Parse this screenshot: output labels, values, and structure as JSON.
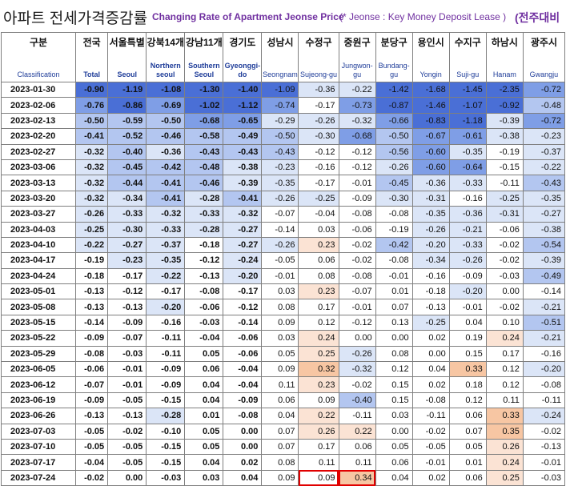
{
  "title": {
    "korean": "아파트 전세가격증감률",
    "english": "Changing Rate of Apartment Jeonse Price",
    "note": "(* Jeonse : Key Money Deposit Lease )",
    "right": "(전주대비"
  },
  "columns": [
    {
      "ko": "구분",
      "en": "Classification"
    },
    {
      "ko": "전국",
      "en": "Total"
    },
    {
      "ko": "서울특별",
      "en": "Seoul"
    },
    {
      "ko": "강북14개",
      "en": "Northern seoul"
    },
    {
      "ko": "강남11개",
      "en": "Southern Seoul"
    },
    {
      "ko": "경기도",
      "en": "Gyeonggi-do"
    },
    {
      "ko": "성남시",
      "en": "Seongnam"
    },
    {
      "ko": "수정구",
      "en": "Sujeong-gu"
    },
    {
      "ko": "중원구",
      "en": "Jungwon-gu"
    },
    {
      "ko": "분당구",
      "en": "Bundang-gu"
    },
    {
      "ko": "용인시",
      "en": "Yongin"
    },
    {
      "ko": "수지구",
      "en": "Suji-gu"
    },
    {
      "ko": "하남시",
      "en": "Hanam"
    },
    {
      "ko": "광주시",
      "en": "Gwangju"
    }
  ],
  "colors": {
    "strong_neg": "#4a6fd6",
    "mid_neg": "#7f9ee6",
    "light_neg": "#b3c6f0",
    "pale_neg": "#dbe5f7",
    "neutral": "#ffffff",
    "pale_pos": "#fbe3d4",
    "light_pos": "#f7c6a3",
    "highlight_border": "#e00000",
    "title_purple": "#7030a0"
  },
  "chart_data": {
    "type": "table",
    "title": "Changing Rate of Apartment Jeonse Price",
    "categories": [
      "2023-01-30",
      "2023-02-06",
      "2023-02-13",
      "2023-02-20",
      "2023-02-27",
      "2023-03-06",
      "2023-03-13",
      "2023-03-20",
      "2023-03-27",
      "2023-04-03",
      "2023-04-10",
      "2023-04-17",
      "2023-04-24",
      "2023-05-01",
      "2023-05-08",
      "2023-05-15",
      "2023-05-22",
      "2023-05-29",
      "2023-06-05",
      "2023-06-12",
      "2023-06-19",
      "2023-06-26",
      "2023-07-03",
      "2023-07-10",
      "2023-07-17",
      "2023-07-24"
    ],
    "rows": [
      [
        "2023-01-30",
        "-0.90",
        "-1.19",
        "-1.08",
        "-1.30",
        "-1.40",
        "-1.09",
        "-0.36",
        "-0.22",
        "-1.42",
        "-1.68",
        "-1.45",
        "-2.35",
        "-0.72"
      ],
      [
        "2023-02-06",
        "-0.76",
        "-0.86",
        "-0.69",
        "-1.02",
        "-1.12",
        "-0.74",
        "-0.17",
        "-0.73",
        "-0.87",
        "-1.46",
        "-1.07",
        "-0.92",
        "-0.48"
      ],
      [
        "2023-02-13",
        "-0.50",
        "-0.59",
        "-0.50",
        "-0.68",
        "-0.65",
        "-0.29",
        "-0.26",
        "-0.32",
        "-0.66",
        "-0.83",
        "-1.18",
        "-0.39",
        "-0.72"
      ],
      [
        "2023-02-20",
        "-0.41",
        "-0.52",
        "-0.46",
        "-0.58",
        "-0.49",
        "-0.50",
        "-0.30",
        "-0.68",
        "-0.50",
        "-0.67",
        "-0.61",
        "-0.38",
        "-0.23"
      ],
      [
        "2023-02-27",
        "-0.32",
        "-0.40",
        "-0.36",
        "-0.43",
        "-0.43",
        "-0.43",
        "-0.12",
        "-0.12",
        "-0.56",
        "-0.60",
        "-0.35",
        "-0.19",
        "-0.37"
      ],
      [
        "2023-03-06",
        "-0.32",
        "-0.45",
        "-0.42",
        "-0.48",
        "-0.38",
        "-0.23",
        "-0.16",
        "-0.12",
        "-0.26",
        "-0.60",
        "-0.64",
        "-0.15",
        "-0.22"
      ],
      [
        "2023-03-13",
        "-0.32",
        "-0.44",
        "-0.41",
        "-0.46",
        "-0.39",
        "-0.35",
        "-0.17",
        "-0.01",
        "-0.45",
        "-0.36",
        "-0.33",
        "-0.11",
        "-0.43"
      ],
      [
        "2023-03-20",
        "-0.32",
        "-0.34",
        "-0.41",
        "-0.28",
        "-0.41",
        "-0.26",
        "-0.25",
        "-0.09",
        "-0.30",
        "-0.31",
        "-0.16",
        "-0.25",
        "-0.35"
      ],
      [
        "2023-03-27",
        "-0.26",
        "-0.33",
        "-0.32",
        "-0.33",
        "-0.32",
        "-0.07",
        "-0.04",
        "-0.08",
        "-0.08",
        "-0.35",
        "-0.36",
        "-0.31",
        "-0.27"
      ],
      [
        "2023-04-03",
        "-0.25",
        "-0.30",
        "-0.33",
        "-0.28",
        "-0.27",
        "-0.14",
        "0.03",
        "-0.06",
        "-0.19",
        "-0.26",
        "-0.21",
        "-0.06",
        "-0.38"
      ],
      [
        "2023-04-10",
        "-0.22",
        "-0.27",
        "-0.37",
        "-0.18",
        "-0.27",
        "-0.26",
        "0.23",
        "-0.02",
        "-0.42",
        "-0.20",
        "-0.33",
        "-0.02",
        "-0.54"
      ],
      [
        "2023-04-17",
        "-0.19",
        "-0.23",
        "-0.35",
        "-0.12",
        "-0.24",
        "-0.05",
        "0.06",
        "-0.02",
        "-0.08",
        "-0.34",
        "-0.26",
        "-0.02",
        "-0.39"
      ],
      [
        "2023-04-24",
        "-0.18",
        "-0.17",
        "-0.22",
        "-0.13",
        "-0.20",
        "-0.01",
        "0.08",
        "-0.08",
        "-0.01",
        "-0.16",
        "-0.09",
        "-0.03",
        "-0.49"
      ],
      [
        "2023-05-01",
        "-0.13",
        "-0.12",
        "-0.17",
        "-0.08",
        "-0.17",
        "0.03",
        "0.23",
        "-0.07",
        "0.01",
        "-0.18",
        "-0.20",
        "0.00",
        "-0.14"
      ],
      [
        "2023-05-08",
        "-0.13",
        "-0.13",
        "-0.20",
        "-0.06",
        "-0.12",
        "0.08",
        "0.17",
        "-0.01",
        "0.07",
        "-0.13",
        "-0.01",
        "-0.02",
        "-0.21"
      ],
      [
        "2023-05-15",
        "-0.14",
        "-0.09",
        "-0.16",
        "-0.03",
        "-0.14",
        "0.09",
        "0.12",
        "-0.12",
        "0.13",
        "-0.25",
        "0.04",
        "0.10",
        "-0.51"
      ],
      [
        "2023-05-22",
        "-0.09",
        "-0.07",
        "-0.11",
        "-0.04",
        "-0.06",
        "0.03",
        "0.24",
        "0.00",
        "0.00",
        "0.02",
        "0.19",
        "0.24",
        "-0.21"
      ],
      [
        "2023-05-29",
        "-0.08",
        "-0.03",
        "-0.11",
        "0.05",
        "-0.06",
        "0.05",
        "0.25",
        "-0.26",
        "0.08",
        "0.00",
        "0.15",
        "0.17",
        "-0.16"
      ],
      [
        "2023-06-05",
        "-0.06",
        "-0.01",
        "-0.09",
        "0.06",
        "-0.04",
        "0.09",
        "0.32",
        "-0.32",
        "0.12",
        "0.04",
        "0.33",
        "0.12",
        "-0.20"
      ],
      [
        "2023-06-12",
        "-0.07",
        "-0.01",
        "-0.09",
        "0.04",
        "-0.04",
        "0.11",
        "0.23",
        "-0.02",
        "0.15",
        "0.02",
        "0.18",
        "0.12",
        "-0.08"
      ],
      [
        "2023-06-19",
        "-0.09",
        "-0.05",
        "-0.15",
        "0.04",
        "-0.09",
        "0.06",
        "0.09",
        "-0.40",
        "0.15",
        "-0.08",
        "0.12",
        "0.11",
        "-0.11"
      ],
      [
        "2023-06-26",
        "-0.13",
        "-0.13",
        "-0.28",
        "0.01",
        "-0.08",
        "0.04",
        "0.22",
        "-0.11",
        "0.03",
        "-0.11",
        "0.06",
        "0.33",
        "-0.24"
      ],
      [
        "2023-07-03",
        "-0.05",
        "-0.02",
        "-0.10",
        "0.05",
        "0.00",
        "0.07",
        "0.26",
        "0.22",
        "0.00",
        "-0.02",
        "0.07",
        "0.35",
        "-0.02"
      ],
      [
        "2023-07-10",
        "-0.05",
        "-0.05",
        "-0.15",
        "0.05",
        "0.00",
        "0.07",
        "0.17",
        "0.06",
        "0.05",
        "-0.05",
        "0.05",
        "0.26",
        "-0.13"
      ],
      [
        "2023-07-17",
        "-0.04",
        "-0.05",
        "-0.15",
        "0.04",
        "0.02",
        "0.08",
        "0.11",
        "0.11",
        "0.06",
        "-0.01",
        "0.01",
        "0.24",
        "-0.01"
      ],
      [
        "2023-07-24",
        "-0.02",
        "0.00",
        "-0.03",
        "0.03",
        "0.04",
        "0.09",
        "0.09",
        "0.34",
        "0.04",
        "0.02",
        "0.06",
        "0.25",
        "-0.03"
      ]
    ],
    "highlighted_cells": [
      [
        25,
        7
      ],
      [
        25,
        8
      ]
    ],
    "grid": true
  }
}
